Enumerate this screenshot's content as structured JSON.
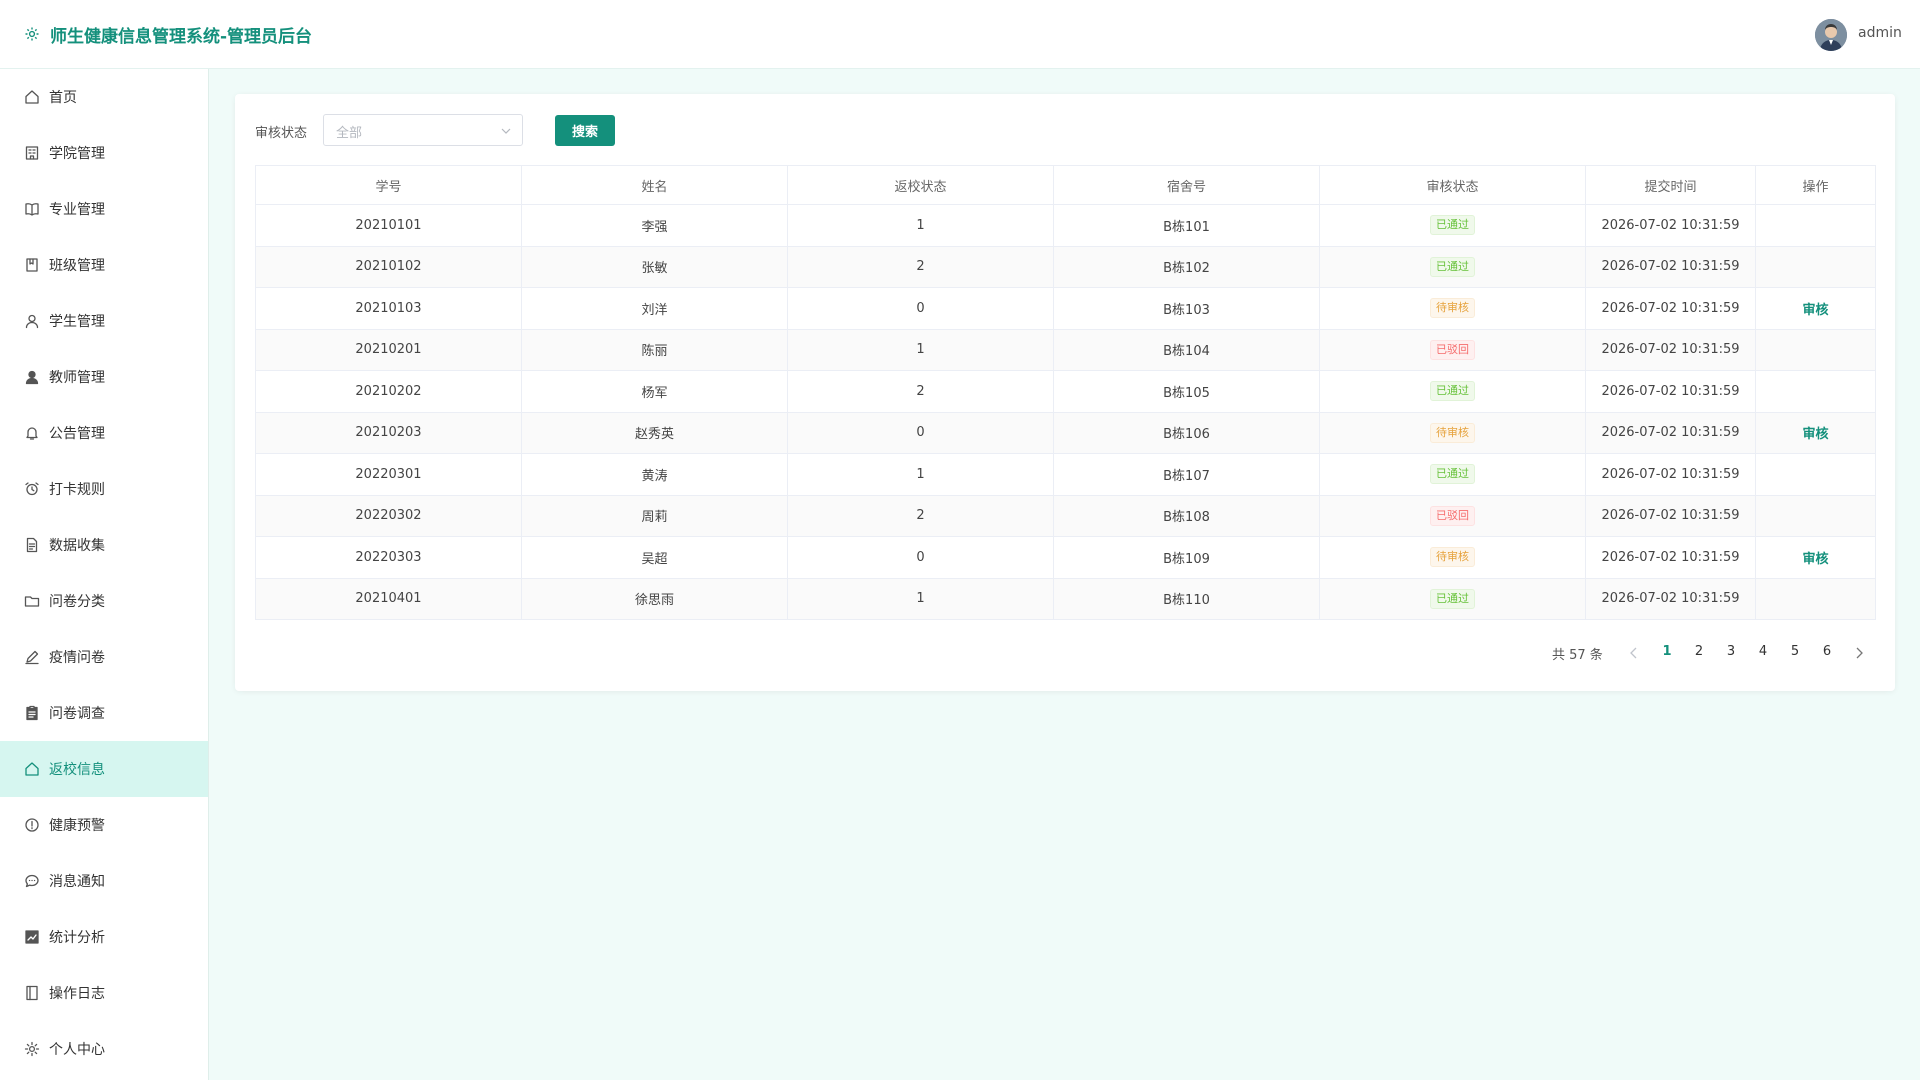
{
  "header": {
    "title": "师生健康信息管理系统-管理员后台",
    "user_name": "admin"
  },
  "sidebar": {
    "items": [
      {
        "label": "首页",
        "icon": "home-icon"
      },
      {
        "label": "学院管理",
        "icon": "building-icon"
      },
      {
        "label": "专业管理",
        "icon": "book-icon"
      },
      {
        "label": "班级管理",
        "icon": "notebook-icon"
      },
      {
        "label": "学生管理",
        "icon": "user-icon"
      },
      {
        "label": "教师管理",
        "icon": "user-filled-icon"
      },
      {
        "label": "公告管理",
        "icon": "bell-icon"
      },
      {
        "label": "打卡规则",
        "icon": "alarm-clock-icon"
      },
      {
        "label": "数据收集",
        "icon": "document-icon"
      },
      {
        "label": "问卷分类",
        "icon": "folder-icon"
      },
      {
        "label": "疫情问卷",
        "icon": "edit-pen-icon"
      },
      {
        "label": "问卷调查",
        "icon": "clipboard-icon"
      },
      {
        "label": "返校信息",
        "icon": "home-icon",
        "active": true
      },
      {
        "label": "健康预警",
        "icon": "warning-icon"
      },
      {
        "label": "消息通知",
        "icon": "chat-icon"
      },
      {
        "label": "统计分析",
        "icon": "chart-icon"
      },
      {
        "label": "操作日志",
        "icon": "log-book-icon"
      },
      {
        "label": "个人中心",
        "icon": "gear-icon"
      }
    ]
  },
  "filter": {
    "label": "审核状态",
    "select_value": "全部",
    "search_label": "搜索"
  },
  "table": {
    "columns": [
      "学号",
      "姓名",
      "返校状态",
      "宿舍号",
      "审核状态",
      "提交时间",
      "操作"
    ],
    "rows": [
      {
        "id": "20210101",
        "name": "李强",
        "status": "1",
        "dorm": "B栋101",
        "review": "已通过",
        "review_type": "passed",
        "time": "2026-07-02 10:31:59",
        "action": ""
      },
      {
        "id": "20210102",
        "name": "张敏",
        "status": "2",
        "dorm": "B栋102",
        "review": "已通过",
        "review_type": "passed",
        "time": "2026-07-02 10:31:59",
        "action": ""
      },
      {
        "id": "20210103",
        "name": "刘洋",
        "status": "0",
        "dorm": "B栋103",
        "review": "待审核",
        "review_type": "pending",
        "time": "2026-07-02 10:31:59",
        "action": "审核"
      },
      {
        "id": "20210201",
        "name": "陈丽",
        "status": "1",
        "dorm": "B栋104",
        "review": "已驳回",
        "review_type": "rejected",
        "time": "2026-07-02 10:31:59",
        "action": ""
      },
      {
        "id": "20210202",
        "name": "杨军",
        "status": "2",
        "dorm": "B栋105",
        "review": "已通过",
        "review_type": "passed",
        "time": "2026-07-02 10:31:59",
        "action": ""
      },
      {
        "id": "20210203",
        "name": "赵秀英",
        "status": "0",
        "dorm": "B栋106",
        "review": "待审核",
        "review_type": "pending",
        "time": "2026-07-02 10:31:59",
        "action": "审核"
      },
      {
        "id": "20220301",
        "name": "黄涛",
        "status": "1",
        "dorm": "B栋107",
        "review": "已通过",
        "review_type": "passed",
        "time": "2026-07-02 10:31:59",
        "action": ""
      },
      {
        "id": "20220302",
        "name": "周莉",
        "status": "2",
        "dorm": "B栋108",
        "review": "已驳回",
        "review_type": "rejected",
        "time": "2026-07-02 10:31:59",
        "action": ""
      },
      {
        "id": "20220303",
        "name": "吴超",
        "status": "0",
        "dorm": "B栋109",
        "review": "待审核",
        "review_type": "pending",
        "time": "2026-07-02 10:31:59",
        "action": "审核"
      },
      {
        "id": "20210401",
        "name": "徐思雨",
        "status": "1",
        "dorm": "B栋110",
        "review": "已通过",
        "review_type": "passed",
        "time": "2026-07-02 10:31:59",
        "action": ""
      }
    ]
  },
  "pagination": {
    "total_text": "共 57 条",
    "pages": [
      "1",
      "2",
      "3",
      "4",
      "5",
      "6"
    ],
    "current": "1"
  },
  "colors": {
    "accent": "#14907c",
    "active_bg": "#d6f6f0",
    "page_bg": "#f0fbf9",
    "tag_passed": "#67c23a",
    "tag_pending": "#e6a23c",
    "tag_rejected": "#f56c6c"
  }
}
